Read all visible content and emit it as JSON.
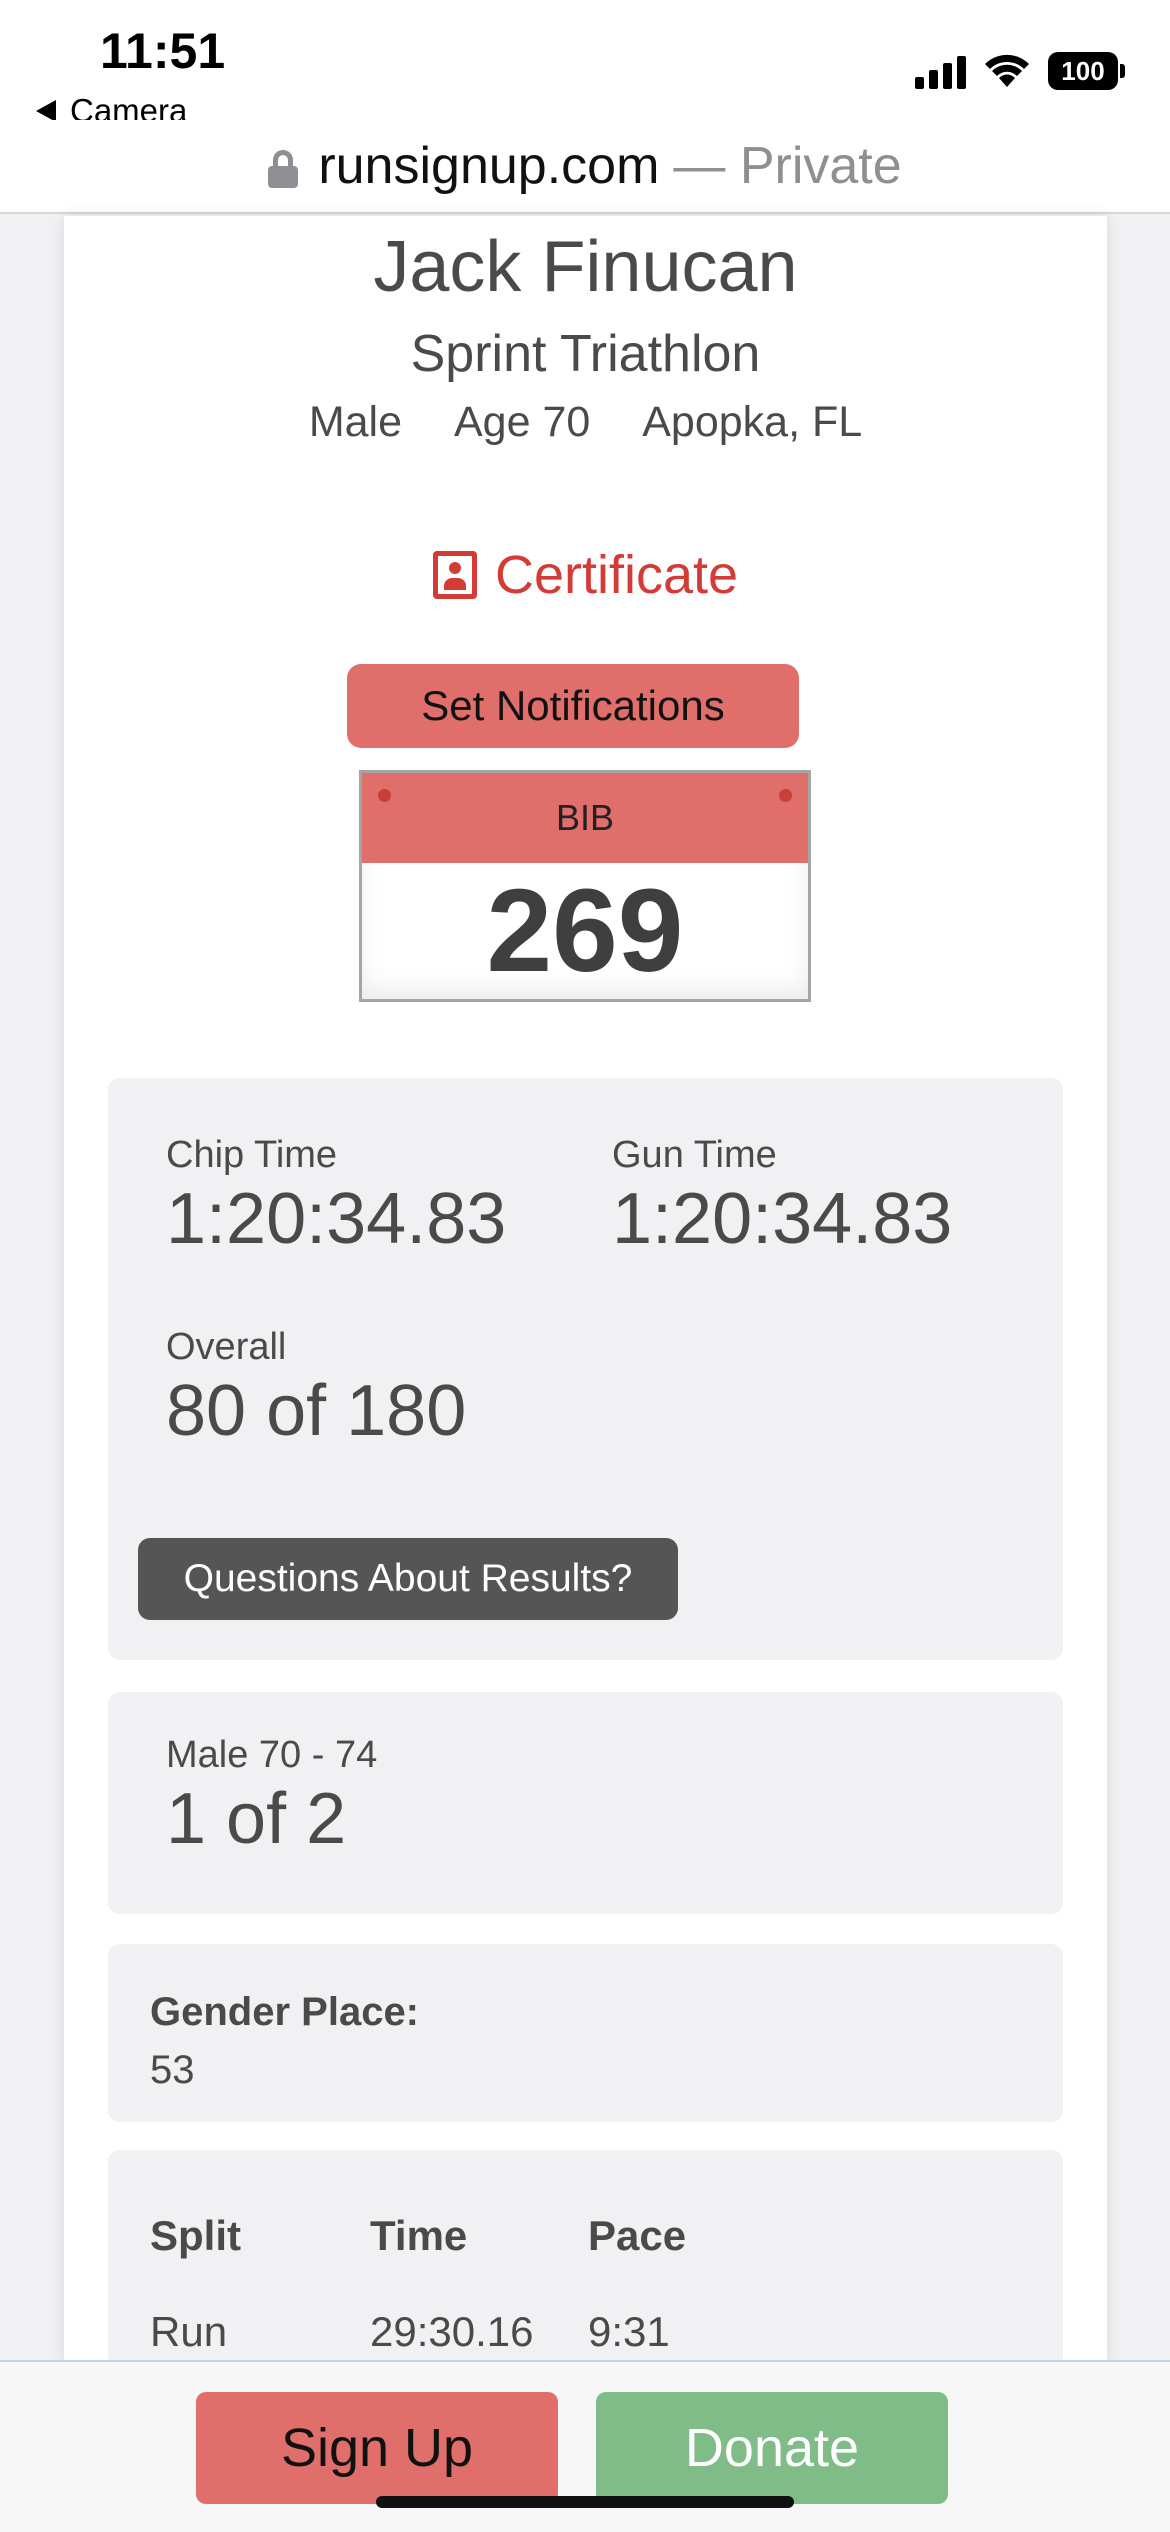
{
  "status_bar": {
    "time": "11:51",
    "back_app": "Camera",
    "battery": "100"
  },
  "url_bar": {
    "domain": "runsignup.com",
    "suffix": "— Private"
  },
  "participant": {
    "name": "Jack Finucan",
    "event": "Sprint Triathlon",
    "gender": "Male",
    "age": "Age 70",
    "location": "Apopka, FL"
  },
  "actions": {
    "certificate_label": "Certificate",
    "notifications_label": "Set Notifications",
    "questions_label": "Questions About Results?"
  },
  "bib": {
    "label": "BIB",
    "number": "269"
  },
  "results": {
    "chip_time_label": "Chip Time",
    "chip_time": "1:20:34.83",
    "gun_time_label": "Gun Time",
    "gun_time": "1:20:34.83",
    "overall_label": "Overall",
    "overall": "80 of 180"
  },
  "age_group": {
    "label": "Male 70 - 74",
    "place": "1 of 2"
  },
  "gender_place": {
    "label": "Gender Place:",
    "value": "53"
  },
  "splits": {
    "headers": [
      "Split",
      "Time",
      "Pace"
    ],
    "rows": [
      [
        "Run",
        "29:30.16",
        "9:31"
      ]
    ]
  },
  "bottom_bar": {
    "signup_label": "Sign Up",
    "donate_label": "Donate"
  },
  "colors": {
    "accent_red": "#e06e6a",
    "certificate_red": "#d33c36",
    "donate_green": "#7fbc88",
    "panel_gray": "#f1f1f3"
  }
}
